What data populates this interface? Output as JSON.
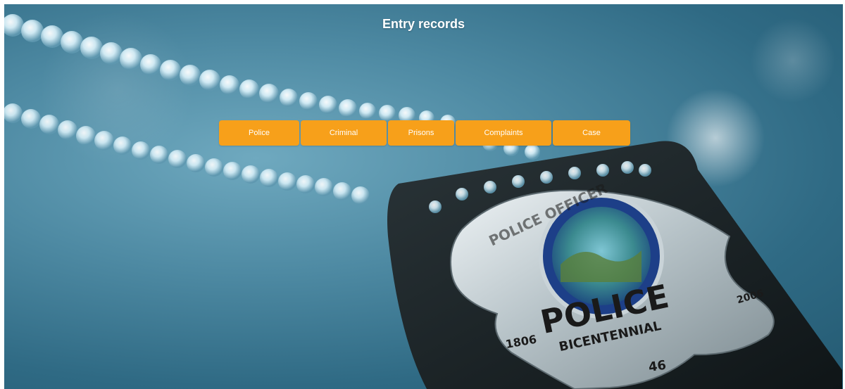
{
  "page": {
    "title": "Entry records"
  },
  "nav": {
    "items": [
      {
        "label": "Police"
      },
      {
        "label": "Criminal"
      },
      {
        "label": "Prisons"
      },
      {
        "label": "Complaints"
      },
      {
        "label": "Case"
      }
    ]
  },
  "colors": {
    "button_bg": "#f7a01a",
    "button_text": "#ffffff",
    "title_text": "#ffffff"
  },
  "background": {
    "image_subject": "police-badge-photo",
    "badge_lettering": {
      "top": "POLICE OFFICER",
      "main": "POLICE",
      "banner": "BICENTENNIAL",
      "year_left": "1806",
      "year_right": "2006",
      "number": "46"
    }
  }
}
